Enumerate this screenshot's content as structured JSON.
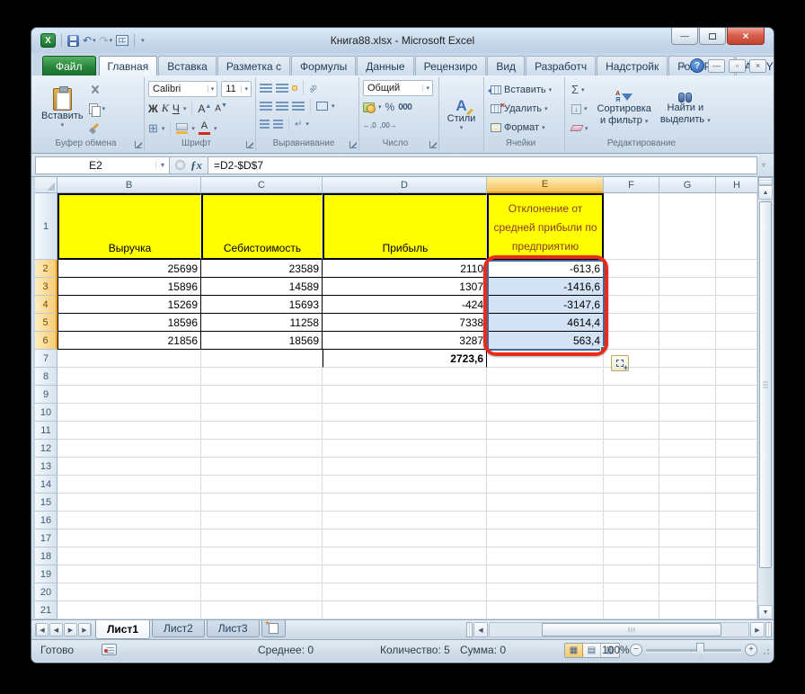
{
  "window": {
    "title": "Книга88.xlsx  -  Microsoft Excel"
  },
  "tabs": {
    "file": "Файл",
    "items": [
      "Главная",
      "Вставка",
      "Разметка с",
      "Формулы",
      "Данные",
      "Рецензиро",
      "Вид",
      "Разработч",
      "Надстройк",
      "Foxit PDF",
      "ABBYY PDF"
    ],
    "active": "Главная"
  },
  "ribbon": {
    "clipboard": {
      "paste": "Вставить",
      "group": "Буфер обмена"
    },
    "font": {
      "name": "Calibri",
      "size": "11",
      "bold": "Ж",
      "italic": "К",
      "underline": "Ч",
      "grow": "А",
      "shrink": "А",
      "group": "Шрифт"
    },
    "alignment": {
      "group": "Выравнивание",
      "orientation": "ab"
    },
    "number": {
      "format": "Общий",
      "percent": "%",
      "thousands": "000",
      "decimal_increase": "←,0",
      "decimal_decrease": ",00→",
      "group": "Число"
    },
    "styles": {
      "label": "Стили"
    },
    "cells": {
      "insert": "Вставить",
      "delete": "Удалить",
      "format": "Формат",
      "group": "Ячейки"
    },
    "editing": {
      "sigma": "Σ",
      "sort_line1": "Сортировка",
      "sort_line2": "и фильтр",
      "find_line1": "Найти и",
      "find_line2": "выделить",
      "group": "Редактирование"
    }
  },
  "formula_bar": {
    "name_box": "E2",
    "fx": "ƒx",
    "formula": "=D2-$D$7"
  },
  "sheet": {
    "columns": [
      "B",
      "C",
      "D",
      "E",
      "F",
      "G",
      "H"
    ],
    "selected_column": "E",
    "row_numbers": [
      "1",
      "2",
      "3",
      "4",
      "5",
      "6",
      "7",
      "8",
      "9",
      "10",
      "11",
      "12",
      "13",
      "14",
      "15",
      "16",
      "17",
      "18",
      "19",
      "20",
      "21"
    ],
    "headers": {
      "B": "Выручка",
      "C": "Себистоимость",
      "D": "Прибыль",
      "E": "Отклонение от средней прибыли по предприятию"
    },
    "rows": {
      "r2": {
        "B": "25699",
        "C": "23589",
        "D": "2110",
        "E": "-613,6"
      },
      "r3": {
        "B": "15896",
        "C": "14589",
        "D": "1307",
        "E": "-1416,6"
      },
      "r4": {
        "B": "15269",
        "C": "15693",
        "D": "-424",
        "E": "-3147,6"
      },
      "r5": {
        "B": "18596",
        "C": "11258",
        "D": "7338",
        "E": "4614,4"
      },
      "r6": {
        "B": "21856",
        "C": "18569",
        "D": "3287",
        "E": "563,4"
      },
      "r7": {
        "D": "2723,6"
      }
    }
  },
  "sheet_tabs": {
    "tabs": [
      "Лист1",
      "Лист2",
      "Лист3"
    ],
    "active": "Лист1"
  },
  "status_bar": {
    "mode": "Готово",
    "average": "Среднее: 0",
    "count": "Количество: 5",
    "sum": "Сумма: 0",
    "zoom": "100%"
  },
  "glyphs": {
    "dropdown": "▾",
    "undo": "↶",
    "redo": "↷",
    "caret_up": "∧",
    "help": "?",
    "minimize": "—",
    "close": "×",
    "scroll_left": "◀",
    "scroll_right": "▶",
    "scroll_up": "▲",
    "scroll_down": "▼",
    "borders": "⊞",
    "fill_down": "↓",
    "wrap_return": "↵",
    "merge": "⊡",
    "expand": "▿",
    "view_normal": "▦",
    "view_layout": "▤",
    "view_break": "▥",
    "zoom_out": "−",
    "zoom_in": "+",
    "sort_a": "А",
    "sort_z": "Я",
    "x_logo": "X"
  },
  "colors": {
    "annotation_red": "#ea2a1b",
    "header_fill": "#ffff00",
    "selection_fill": "#d3e3f5",
    "file_tab_green": "#27863c"
  }
}
